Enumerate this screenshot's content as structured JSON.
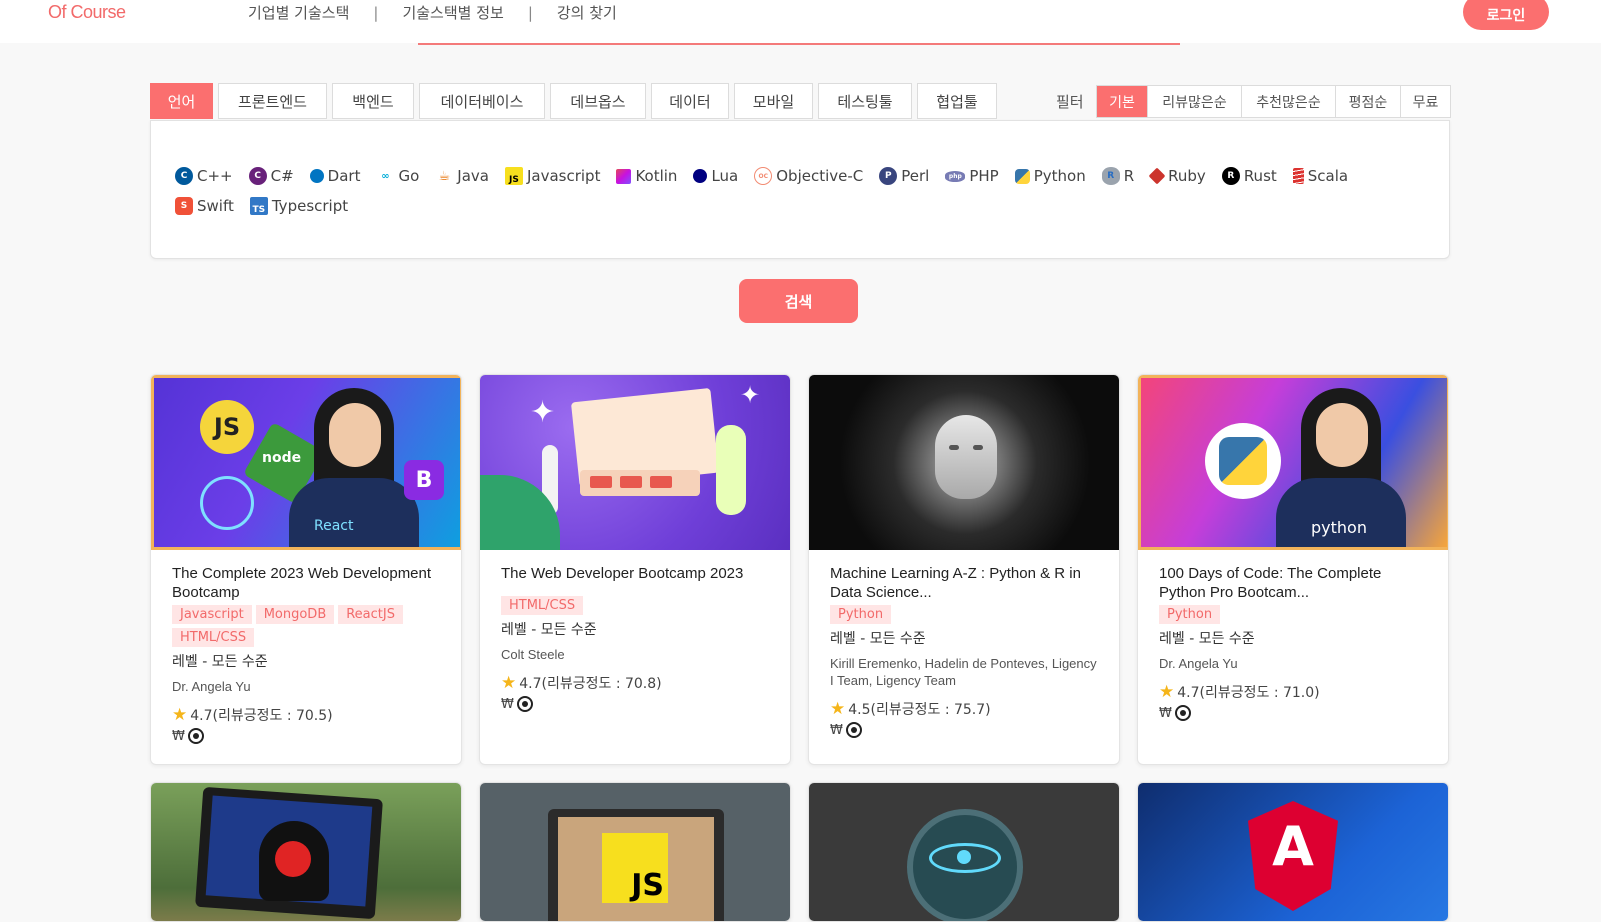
{
  "header": {
    "logo": "Of Course",
    "nav": [
      "기업별 기술스택",
      "기술스택별 정보",
      "강의 찾기"
    ],
    "nav_separator": "|",
    "login": "로그인"
  },
  "categories": [
    "언어",
    "프론트엔드",
    "백엔드",
    "데이터베이스",
    "데브옵스",
    "데이터",
    "모바일",
    "테스팅툴",
    "협업툴"
  ],
  "filter": {
    "label": "필터",
    "options": [
      "기본",
      "리뷰많은순",
      "추천많은순",
      "평점순",
      "무료"
    ]
  },
  "languages": [
    {
      "name": "C++",
      "icon": "cpp-icon",
      "color": "#00599c"
    },
    {
      "name": "C#",
      "icon": "csharp-icon",
      "color": "#68217a"
    },
    {
      "name": "Dart",
      "icon": "dart-icon",
      "color": "#0175c2"
    },
    {
      "name": "Go",
      "icon": "go-icon",
      "color": "#00add8"
    },
    {
      "name": "Java",
      "icon": "java-icon",
      "color": "#e76f00"
    },
    {
      "name": "Javascript",
      "icon": "javascript-icon",
      "color": "#f7df1e"
    },
    {
      "name": "Kotlin",
      "icon": "kotlin-icon",
      "color": "#7f52ff"
    },
    {
      "name": "Lua",
      "icon": "lua-icon",
      "color": "#000080"
    },
    {
      "name": "Objective-C",
      "icon": "objective-c-icon",
      "color": "#f28b72"
    },
    {
      "name": "Perl",
      "icon": "perl-icon",
      "color": "#39457e"
    },
    {
      "name": "PHP",
      "icon": "php-icon",
      "color": "#777bb4"
    },
    {
      "name": "Python",
      "icon": "python-icon",
      "color": "#3776ab"
    },
    {
      "name": "R",
      "icon": "r-icon",
      "color": "#276dc3"
    },
    {
      "name": "Ruby",
      "icon": "ruby-icon",
      "color": "#cc342d"
    },
    {
      "name": "Rust",
      "icon": "rust-icon",
      "color": "#000000"
    },
    {
      "name": "Scala",
      "icon": "scala-icon",
      "color": "#dc322f"
    },
    {
      "name": "Swift",
      "icon": "swift-icon",
      "color": "#f05138"
    },
    {
      "name": "Typescript",
      "icon": "typescript-icon",
      "color": "#3178c6"
    }
  ],
  "search_button": "검색",
  "courses": [
    {
      "title": "The Complete 2023 Web Development Bootcamp",
      "tags": [
        "Javascript",
        "MongoDB",
        "ReactJS",
        "HTML/CSS"
      ],
      "level": "레벨 - 모든 수준",
      "instructor": "Dr. Angela Yu",
      "rating": "4.7(리뷰긍정도 : 70.5)",
      "price": "₩",
      "thumb_labels": [
        "JS",
        "node",
        "React",
        "B"
      ]
    },
    {
      "title": "The Web Developer Bootcamp 2023",
      "tags": [
        "HTML/CSS"
      ],
      "level": "레벨 - 모든 수준",
      "instructor": "Colt Steele",
      "rating": "4.7(리뷰긍정도 : 70.8)",
      "price": "₩"
    },
    {
      "title": "Machine Learning A-Z : Python & R in Data Science...",
      "tags": [
        "Python"
      ],
      "level": "레벨 - 모든 수준",
      "instructor": "Kirill Eremenko, Hadelin de Ponteves, Ligency I Team, Ligency Team",
      "rating": "4.5(리뷰긍정도 : 75.7)",
      "price": "₩"
    },
    {
      "title": "100 Days of Code: The Complete Python Pro Bootcam...",
      "tags": [
        "Python"
      ],
      "level": "레벨 - 모든 수준",
      "instructor": "Dr. Angela Yu",
      "rating": "4.7(리뷰긍정도 : 71.0)",
      "price": "₩",
      "thumb_labels": [
        "python"
      ]
    }
  ],
  "next_row_thumb_labels": [
    "JS",
    "A"
  ],
  "colors": {
    "accent": "#fb6f6f",
    "tag_bg": "#ffe5e5",
    "tag_text": "#f26a6a",
    "star": "#f5b51a"
  }
}
